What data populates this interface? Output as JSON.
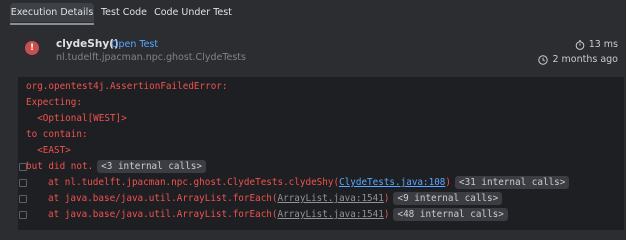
{
  "tabs": [
    "Execution Details",
    "Test Code",
    "Code Under Test"
  ],
  "test": {
    "name": "clydeShy()",
    "open_link": "Open Test",
    "class_path": "nl.tudelft.jpacman.npc.ghost.ClydeTests",
    "duration": "13 ms",
    "when": "2 months ago"
  },
  "console": {
    "lines": [
      "org.opentest4j.AssertionFailedError:",
      "Expecting:",
      "  <Optional[WEST]>",
      "to contain:",
      "  <EAST>",
      "but did not."
    ],
    "collapsed1": "<3 internal calls>",
    "stack": [
      {
        "prefix": "at nl.tudelft.jpacman.npc.ghost.ClydeTests.clydeShy(",
        "link": "ClydeTests.java:108",
        "suffix": ")",
        "chip": "<31 internal calls>",
        "link_type": "project"
      },
      {
        "prefix": "at java.base/java.util.ArrayList.forEach(",
        "link": "ArrayList.java:1541",
        "suffix": ")",
        "chip": "<9 internal calls>",
        "link_type": "library"
      },
      {
        "prefix": "at java.base/java.util.ArrayList.forEach(",
        "link": "ArrayList.java:1541",
        "suffix": ")",
        "chip": "<48 internal calls>",
        "link_type": "library"
      }
    ]
  },
  "colors": {
    "background": "#2b2d30",
    "console_bg": "#1e1f22",
    "error_text": "#f0524f",
    "link": "#5aa7ff",
    "error_icon": "#c94f4f"
  }
}
